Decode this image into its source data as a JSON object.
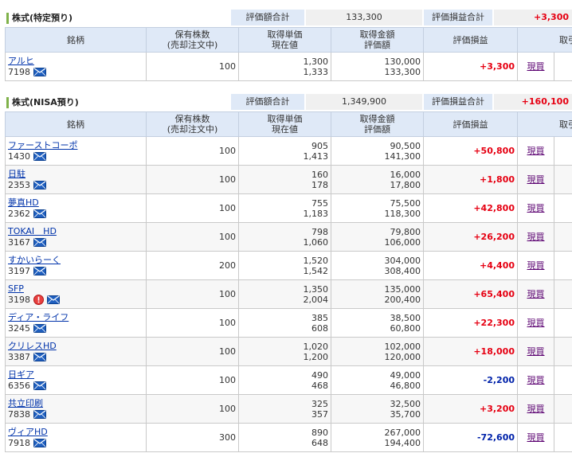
{
  "section1": {
    "title": "株式(特定預り)",
    "summary": {
      "eval_label": "評価額合計",
      "eval_value": "133,300",
      "gain_label": "評価損益合計",
      "gain_value": "+3,300"
    },
    "headers": {
      "symbol": "銘柄",
      "shares_1": "保有株数",
      "shares_2": "(売却注文中)",
      "price_1": "取得単価",
      "price_2": "現在値",
      "amount_1": "取得金額",
      "amount_2": "評価額",
      "gain": "評価損益",
      "trade": "取引"
    },
    "rows": [
      {
        "name": "アルヒ",
        "code": "7198",
        "shares": "100",
        "cost_price": "1,300",
        "current_price": "1,333",
        "cost_amount": "130,000",
        "eval_amount": "133,300",
        "gain": "+3,300",
        "gain_sign": "pos",
        "action": "現買",
        "alert": false
      }
    ]
  },
  "section2": {
    "title": "株式(NISA預り)",
    "summary": {
      "eval_label": "評価額合計",
      "eval_value": "1,349,900",
      "gain_label": "評価損益合計",
      "gain_value": "+160,100"
    },
    "headers": {
      "symbol": "銘柄",
      "shares_1": "保有株数",
      "shares_2": "(売却注文中)",
      "price_1": "取得単価",
      "price_2": "現在値",
      "amount_1": "取得金額",
      "amount_2": "評価額",
      "gain": "評価損益",
      "trade": "取引"
    },
    "rows": [
      {
        "name": "ファーストコーポ",
        "code": "1430",
        "shares": "100",
        "cost_price": "905",
        "current_price": "1,413",
        "cost_amount": "90,500",
        "eval_amount": "141,300",
        "gain": "+50,800",
        "gain_sign": "pos",
        "action": "現買",
        "alert": false
      },
      {
        "name": "日駐",
        "code": "2353",
        "shares": "100",
        "cost_price": "160",
        "current_price": "178",
        "cost_amount": "16,000",
        "eval_amount": "17,800",
        "gain": "+1,800",
        "gain_sign": "pos",
        "action": "現買",
        "alert": false
      },
      {
        "name": "夢真HD",
        "code": "2362",
        "shares": "100",
        "cost_price": "755",
        "current_price": "1,183",
        "cost_amount": "75,500",
        "eval_amount": "118,300",
        "gain": "+42,800",
        "gain_sign": "pos",
        "action": "現買",
        "alert": false
      },
      {
        "name": "TOKAI　HD",
        "code": "3167",
        "shares": "100",
        "cost_price": "798",
        "current_price": "1,060",
        "cost_amount": "79,800",
        "eval_amount": "106,000",
        "gain": "+26,200",
        "gain_sign": "pos",
        "action": "現買",
        "alert": false
      },
      {
        "name": "すかいらーく",
        "code": "3197",
        "shares": "200",
        "cost_price": "1,520",
        "current_price": "1,542",
        "cost_amount": "304,000",
        "eval_amount": "308,400",
        "gain": "+4,400",
        "gain_sign": "pos",
        "action": "現買",
        "alert": false
      },
      {
        "name": "SFP",
        "code": "3198",
        "shares": "100",
        "cost_price": "1,350",
        "current_price": "2,004",
        "cost_amount": "135,000",
        "eval_amount": "200,400",
        "gain": "+65,400",
        "gain_sign": "pos",
        "action": "現買",
        "alert": true
      },
      {
        "name": "ディア・ライフ",
        "code": "3245",
        "shares": "100",
        "cost_price": "385",
        "current_price": "608",
        "cost_amount": "38,500",
        "eval_amount": "60,800",
        "gain": "+22,300",
        "gain_sign": "pos",
        "action": "現買",
        "alert": false
      },
      {
        "name": "クリレスHD",
        "code": "3387",
        "shares": "100",
        "cost_price": "1,020",
        "current_price": "1,200",
        "cost_amount": "102,000",
        "eval_amount": "120,000",
        "gain": "+18,000",
        "gain_sign": "pos",
        "action": "現買",
        "alert": false
      },
      {
        "name": "日ギア",
        "code": "6356",
        "shares": "100",
        "cost_price": "490",
        "current_price": "468",
        "cost_amount": "49,000",
        "eval_amount": "46,800",
        "gain": "-2,200",
        "gain_sign": "neg",
        "action": "現買",
        "alert": false
      },
      {
        "name": "共立印刷",
        "code": "7838",
        "shares": "100",
        "cost_price": "325",
        "current_price": "357",
        "cost_amount": "32,500",
        "eval_amount": "35,700",
        "gain": "+3,200",
        "gain_sign": "pos",
        "action": "現買",
        "alert": false
      },
      {
        "name": "ヴィアHD",
        "code": "7918",
        "shares": "300",
        "cost_price": "890",
        "current_price": "648",
        "cost_amount": "267,000",
        "eval_amount": "194,400",
        "gain": "-72,600",
        "gain_sign": "neg",
        "action": "現買",
        "alert": false
      }
    ]
  },
  "icons": {
    "mail": "envelope-icon",
    "alert": "alert-icon"
  },
  "colors": {
    "positive": "#e60012",
    "negative": "#0022aa",
    "header_bg": "#dfe9f7",
    "link": "#0033aa",
    "accent_bar": "#7fb24a"
  }
}
